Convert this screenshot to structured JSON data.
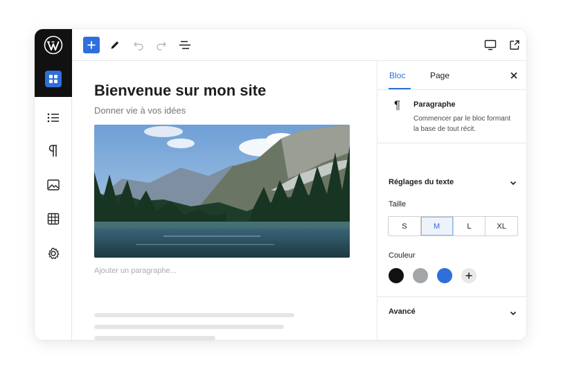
{
  "toolbar": {
    "add_label": "+",
    "icons": [
      "plus-icon",
      "pen-icon",
      "undo-icon",
      "redo-icon",
      "list-view-icon",
      "desktop-preview-icon",
      "external-link-icon",
      "more-vertical-icon"
    ]
  },
  "rail": {
    "icons": [
      "wordpress-logo",
      "blocks-grid-icon",
      "list-icon",
      "paragraph-icon",
      "image-icon",
      "table-icon",
      "settings-icon"
    ]
  },
  "canvas": {
    "title": "Bienvenue sur mon site",
    "subtitle": "Donner vie à vos idées",
    "placeholder": "Ajouter un paragraphe..."
  },
  "sidebar": {
    "tabs": [
      {
        "label": "Bloc",
        "active": true
      },
      {
        "label": "Page",
        "active": false
      }
    ],
    "block": {
      "icon": "¶",
      "name": "Paragraphe",
      "description": "Commencer par le bloc formant la base de tout récit."
    },
    "text_settings": {
      "heading": "Réglages du texte",
      "size_label": "Taille",
      "sizes": [
        "S",
        "M",
        "L",
        "XL"
      ],
      "selected_size": "M",
      "color_label": "Couleur",
      "colors": [
        "#121212",
        "#a3a6a9",
        "#2f6fdb"
      ],
      "add_color_label": "+"
    },
    "advanced": {
      "heading": "Avancé"
    }
  },
  "colors": {
    "accent": "#2f6fdb",
    "dark": "#111111"
  }
}
